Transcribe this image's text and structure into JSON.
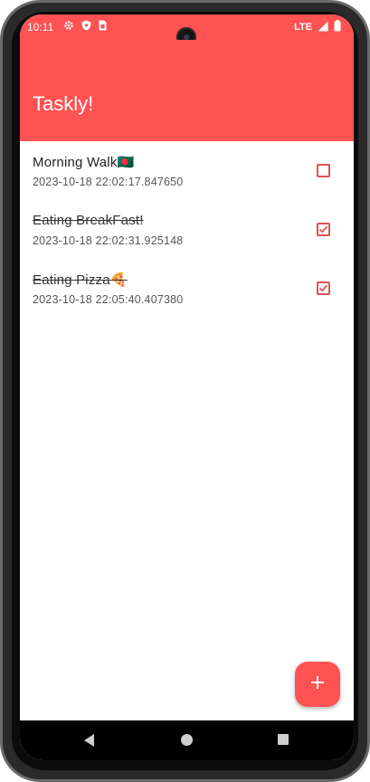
{
  "status_bar": {
    "time": "10:11",
    "network": "LTE",
    "left_icons": [
      "gear-icon",
      "shield-icon",
      "sim-card-icon"
    ],
    "right_icons": [
      "signal-icon",
      "battery-icon"
    ]
  },
  "app_bar": {
    "title": "Taskly!",
    "color": "#ff5252"
  },
  "tasks": [
    {
      "title": "Morning Walk🇧🇩",
      "date": "2023-10-18 22:02:17.847650",
      "done": false
    },
    {
      "title": "Eating BreakFast!",
      "date": "2023-10-18 22:02:31.925148",
      "done": true
    },
    {
      "title": "Eating Pizza🍕",
      "date": "2023-10-18 22:05:40.407380",
      "done": true
    }
  ],
  "fab": {
    "icon": "plus-icon"
  },
  "nav_bar": {
    "icons": [
      "back-icon",
      "home-icon",
      "recents-icon"
    ]
  },
  "colors": {
    "accent": "#ff5252",
    "checkbox": "#e05252"
  }
}
